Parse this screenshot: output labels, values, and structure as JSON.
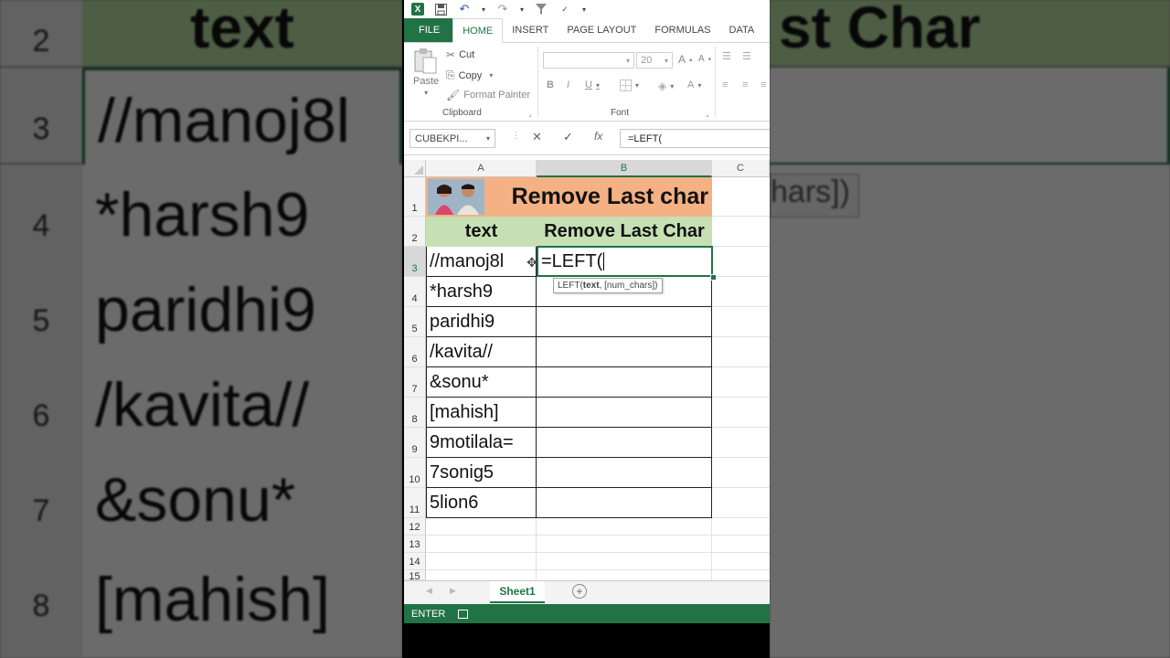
{
  "background": {
    "left_rows": [
      {
        "num": "2",
        "text": "text"
      },
      {
        "num": "3",
        "text": "//manoj8l"
      },
      {
        "num": "4",
        "text": "*harsh9"
      },
      {
        "num": "5",
        "text": "paridhi9"
      },
      {
        "num": "6",
        "text": "/kavita//"
      },
      {
        "num": "7",
        "text": "&sonu*"
      },
      {
        "num": "8",
        "text": "[mahish]"
      }
    ],
    "right_header": "st Char",
    "right_tip": "hars])"
  },
  "qat": {
    "save_icon": "save-icon",
    "undo_icon": "undo-icon",
    "redo_icon": "redo-icon"
  },
  "tabs": [
    "FILE",
    "HOME",
    "INSERT",
    "PAGE LAYOUT",
    "FORMULAS",
    "DATA"
  ],
  "ribbon": {
    "paste_label": "Paste",
    "cut_label": "Cut",
    "copy_label": "Copy",
    "format_painter_label": "Format Painter",
    "clipboard_group": "Clipboard",
    "font_size": "20",
    "bold": "B",
    "italic": "I",
    "underline": "U",
    "grow_font": "A",
    "shrink_font": "A",
    "font_color": "A",
    "font_group": "Font"
  },
  "formula_bar": {
    "name_box": "CUBEKPI...",
    "cancel": "✕",
    "enter": "✓",
    "fx": "fx",
    "content": "=LEFT("
  },
  "columns": [
    "A",
    "B",
    "C"
  ],
  "rows": [
    "1",
    "2",
    "3",
    "4",
    "5",
    "6",
    "7",
    "8",
    "9",
    "10",
    "11",
    "12",
    "13",
    "14",
    "15"
  ],
  "sheet": {
    "title": "Remove Last char",
    "header_a": "text",
    "header_b": "Remove Last Char",
    "active_cell_value": "=LEFT(",
    "tooltip_fn": "LEFT(",
    "tooltip_arg1": "text",
    "tooltip_rest": ", [num_chars])",
    "values": [
      "//manoj8l",
      "*harsh9",
      "paridhi9",
      "/kavita//",
      "&sonu*",
      "[mahish]",
      "9motilala=",
      "7sonig5",
      "5lion6"
    ]
  },
  "sheet_tab": "Sheet1",
  "status": "ENTER",
  "colors": {
    "excel_green": "#217346",
    "title_fill": "#f4b183",
    "header_fill": "#c6e0b4"
  }
}
